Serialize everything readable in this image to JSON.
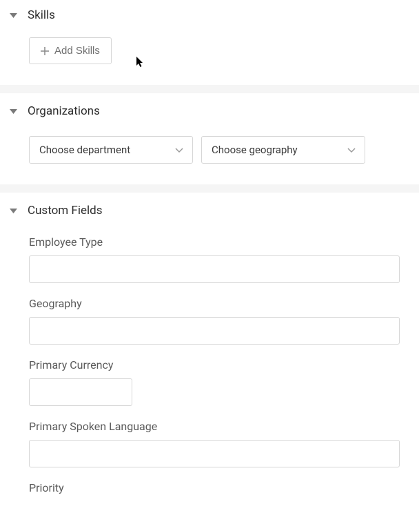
{
  "sections": {
    "skills": {
      "title": "Skills",
      "add_label": "Add Skills"
    },
    "organizations": {
      "title": "Organizations",
      "department_placeholder": "Choose department",
      "geography_placeholder": "Choose geography"
    },
    "custom_fields": {
      "title": "Custom Fields",
      "fields": {
        "employee_type": {
          "label": "Employee Type",
          "value": ""
        },
        "geography": {
          "label": "Geography",
          "value": ""
        },
        "primary_currency": {
          "label": "Primary Currency",
          "value": ""
        },
        "primary_spoken_language": {
          "label": "Primary Spoken Language",
          "value": ""
        },
        "priority": {
          "label": "Priority",
          "value": ""
        }
      }
    }
  }
}
